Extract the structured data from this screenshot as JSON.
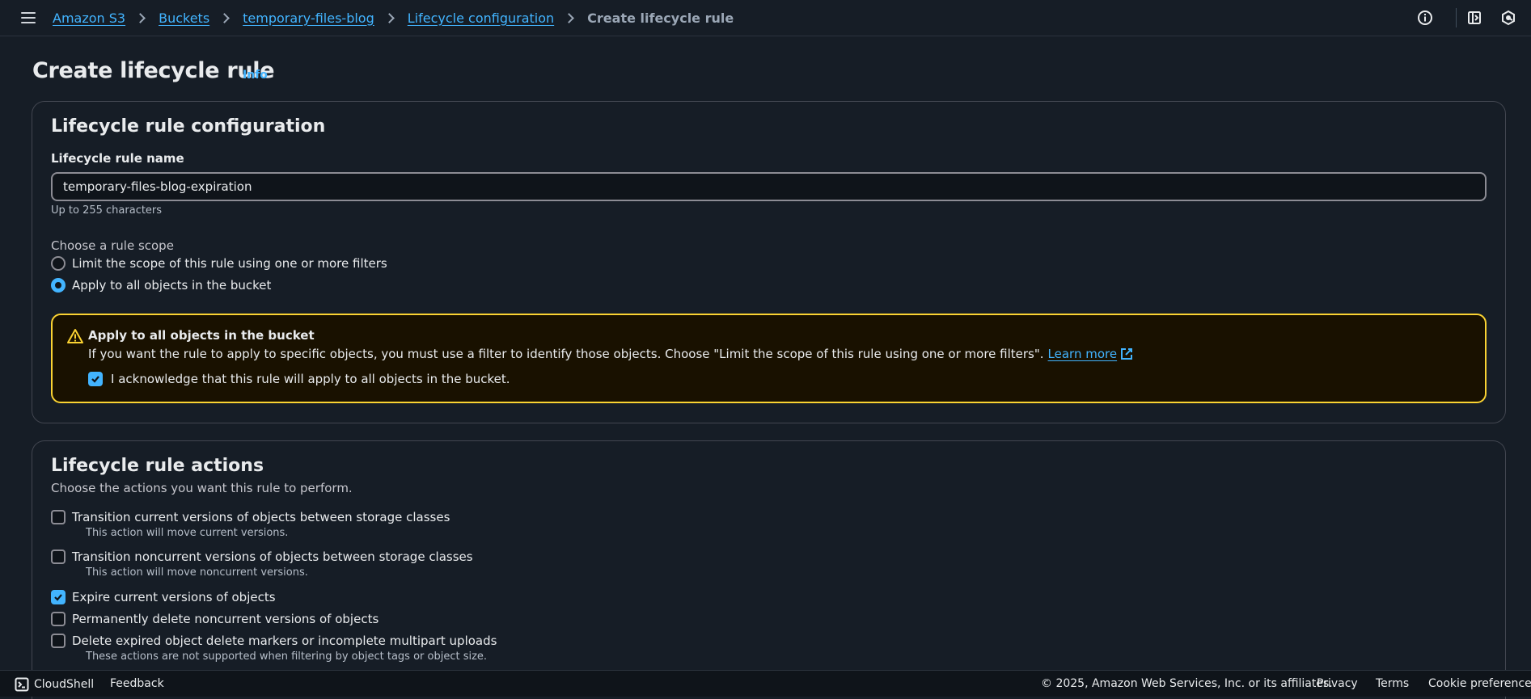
{
  "breadcrumb": {
    "items": [
      "Amazon S3",
      "Buckets",
      "temporary-files-blog",
      "Lifecycle configuration"
    ],
    "current": "Create lifecycle rule"
  },
  "header": {
    "title": "Create lifecycle rule",
    "info_label": "Info"
  },
  "config": {
    "title": "Lifecycle rule configuration",
    "name_label": "Lifecycle rule name",
    "name_value": "temporary-files-blog-expiration",
    "name_hint": "Up to 255 characters",
    "scope_label": "Choose a rule scope",
    "scope_options": [
      {
        "label": "Limit the scope of this rule using one or more filters",
        "selected": false
      },
      {
        "label": "Apply to all objects in the bucket",
        "selected": true
      }
    ],
    "alert": {
      "title": "Apply to all objects in the bucket",
      "text": "If you want the rule to apply to specific objects, you must use a filter to identify those objects. Choose \"Limit the scope of this rule using one or more filters\".",
      "link": "Learn more",
      "acknowledge": "I acknowledge that this rule will apply to all objects in the bucket.",
      "acknowledged": true
    }
  },
  "actions": {
    "title": "Lifecycle rule actions",
    "description": "Choose the actions you want this rule to perform.",
    "items": [
      {
        "label": "Transition current versions of objects between storage classes",
        "description": "This action will move current versions.",
        "checked": false
      },
      {
        "label": "Transition noncurrent versions of objects between storage classes",
        "description": "This action will move noncurrent versions.",
        "checked": false
      },
      {
        "label": "Expire current versions of objects",
        "checked": true
      },
      {
        "label": "Permanently delete noncurrent versions of objects",
        "checked": false
      },
      {
        "label": "Delete expired object delete markers or incomplete multipart uploads",
        "description": "These actions are not supported when filtering by object tags or object size.",
        "checked": false
      }
    ]
  },
  "footer": {
    "cloudshell": "CloudShell",
    "feedback": "Feedback",
    "copyright": "© 2025, Amazon Web Services, Inc. or its affiliates.",
    "privacy": "Privacy",
    "terms": "Terms",
    "cookie": "Cookie preferences"
  },
  "colors": {
    "background": "#161d26",
    "link": "#42b4ff",
    "warning_border": "#fbd332",
    "warning_background": "#191100"
  },
  "icons": [
    "menu-icon",
    "chevron-right-icon",
    "info-circle-icon",
    "notification-panel-icon",
    "settings-hex-icon",
    "warning-icon",
    "external-link-icon",
    "check-icon",
    "cloudshell-icon"
  ]
}
